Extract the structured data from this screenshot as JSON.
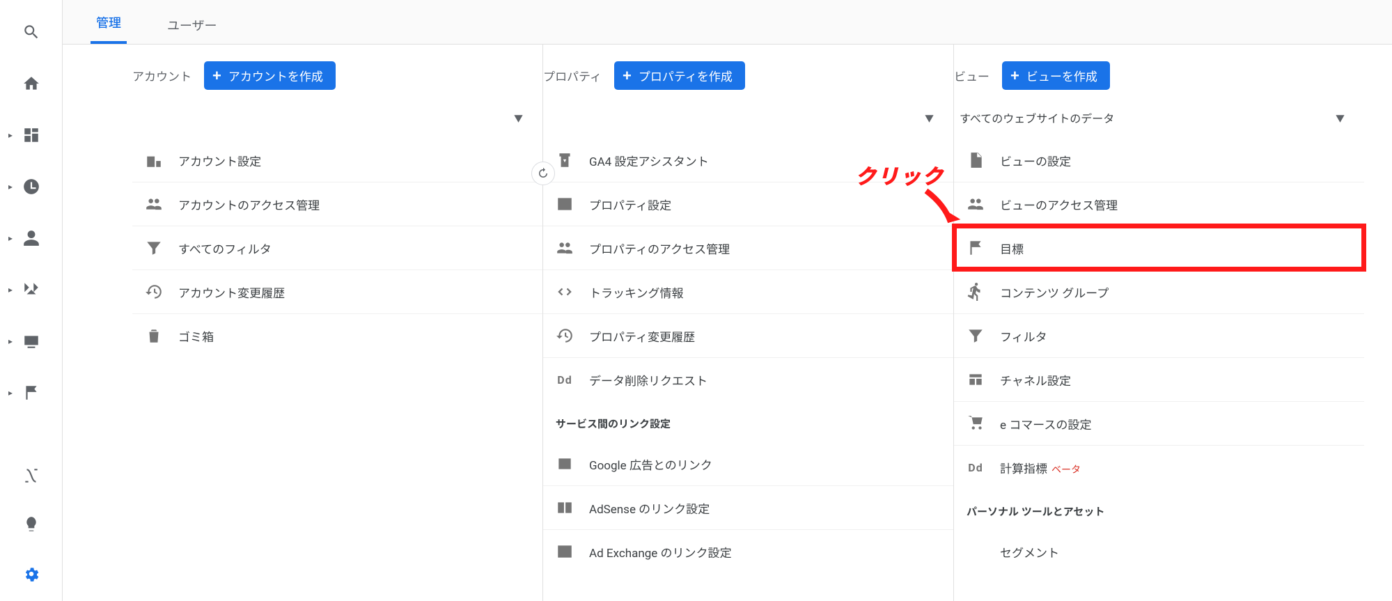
{
  "tabs": {
    "admin": "管理",
    "users": "ユーザー"
  },
  "account": {
    "title": "アカウント",
    "create_label": "アカウントを作成",
    "selected": "",
    "items": [
      {
        "label": "アカウント設定",
        "icon": "building"
      },
      {
        "label": "アカウントのアクセス管理",
        "icon": "people"
      },
      {
        "label": "すべてのフィルタ",
        "icon": "funnel"
      },
      {
        "label": "アカウント変更履歴",
        "icon": "history"
      },
      {
        "label": "ゴミ箱",
        "icon": "trash"
      }
    ]
  },
  "property": {
    "title": "プロパティ",
    "create_label": "プロパティを作成",
    "selected": "",
    "items": [
      {
        "label": "GA4 設定アシスタント",
        "icon": "assistant"
      },
      {
        "label": "プロパティ設定",
        "icon": "layout"
      },
      {
        "label": "プロパティのアクセス管理",
        "icon": "people"
      },
      {
        "label": "トラッキング情報",
        "icon": "code"
      },
      {
        "label": "プロパティ変更履歴",
        "icon": "history"
      },
      {
        "label": "データ削除リクエスト",
        "icon": "dd"
      }
    ],
    "section1_title": "サービス間のリンク設定",
    "links": [
      {
        "label": "Google 広告とのリンク",
        "icon": "ads"
      },
      {
        "label": "AdSense のリンク設定",
        "icon": "adsense"
      },
      {
        "label": "Ad Exchange のリンク設定",
        "icon": "layout"
      }
    ]
  },
  "view": {
    "title": "ビュー",
    "create_label": "ビューを作成",
    "selected": "すべてのウェブサイトのデータ",
    "items": [
      {
        "label": "ビューの設定",
        "icon": "file"
      },
      {
        "label": "ビューのアクセス管理",
        "icon": "people"
      },
      {
        "label": "目標",
        "icon": "flag",
        "highlight": true
      },
      {
        "label": "コンテンツ グループ",
        "icon": "person-run"
      },
      {
        "label": "フィルタ",
        "icon": "funnel"
      },
      {
        "label": "チャネル設定",
        "icon": "channel"
      },
      {
        "label": "e コマースの設定",
        "icon": "cart"
      },
      {
        "label": "計算指標",
        "icon": "dd",
        "beta": "ベータ"
      }
    ],
    "section1_title": "パーソナル ツールとアセット",
    "personal": [
      {
        "label": "セグメント",
        "icon": "segments"
      }
    ]
  },
  "annotation": {
    "text": "クリック"
  }
}
